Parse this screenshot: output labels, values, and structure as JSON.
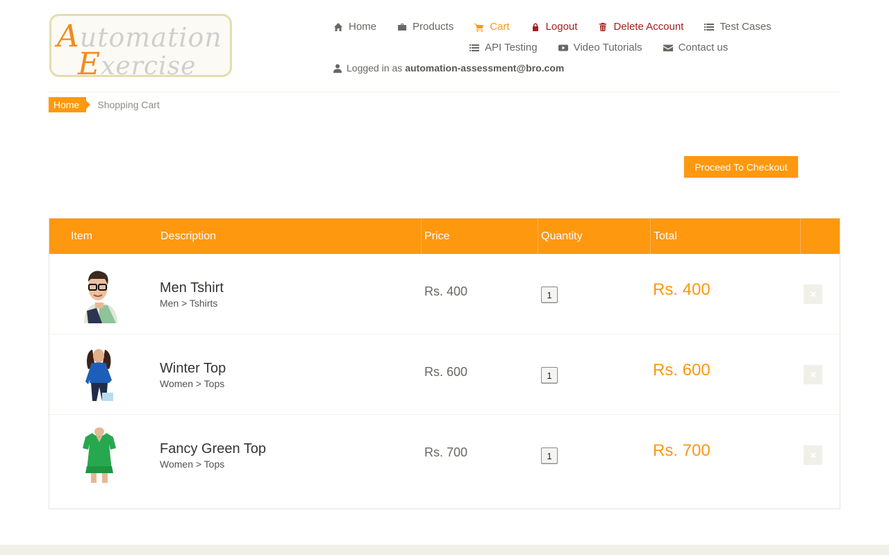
{
  "logo": {
    "line1_cap": "A",
    "line1_rest": "utomation",
    "line2_cap": "E",
    "line2_rest": "xercise"
  },
  "nav": {
    "home": "Home",
    "products": "Products",
    "cart": "Cart",
    "logout": "Logout",
    "delete_account": "Delete Account",
    "test_cases": "Test Cases",
    "api_testing": "API Testing",
    "video_tutorials": "Video Tutorials",
    "contact_us": "Contact us"
  },
  "user": {
    "prefix": "Logged in as",
    "email": "automation-assessment@bro.com"
  },
  "breadcrumb": {
    "home": "Home",
    "active": "Shopping Cart"
  },
  "checkout": {
    "label": "Proceed To Checkout"
  },
  "table": {
    "headers": [
      "Item",
      "Description",
      "Price",
      "Quantity",
      "Total"
    ],
    "rows": [
      {
        "name": "Men Tshirt",
        "category": "Men > Tshirts",
        "price": "Rs. 400",
        "quantity": "1",
        "total": "Rs. 400",
        "image": "man-in-tshirt"
      },
      {
        "name": "Winter Top",
        "category": "Women > Tops",
        "price": "Rs. 600",
        "quantity": "1",
        "total": "Rs. 600",
        "image": "woman-blue-top"
      },
      {
        "name": "Fancy Green Top",
        "category": "Women > Tops",
        "price": "Rs. 700",
        "quantity": "1",
        "total": "Rs. 700",
        "image": "green-top"
      }
    ]
  },
  "colors": {
    "accent": "#fe980f",
    "danger": "#a51e1e",
    "text": "#696763",
    "muted_bg": "#f0f0e9"
  }
}
